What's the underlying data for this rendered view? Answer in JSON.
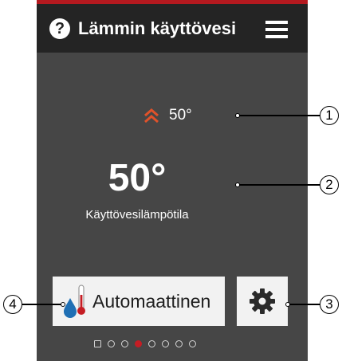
{
  "header": {
    "title": "Lämmin käyttövesi",
    "help_icon_text": "?"
  },
  "setpoint": {
    "value": "50°",
    "icon": "double-chevron-up-icon",
    "icon_color": "#e0522a"
  },
  "current": {
    "value": "50°",
    "label": "Käyttövesilämpötila"
  },
  "mode_button": {
    "label": "Automaattinen",
    "icon": "water-temperature-icon"
  },
  "settings_button": {
    "icon": "gear-icon"
  },
  "pagination": {
    "count": 8,
    "active_index": 3
  },
  "callouts": [
    "1",
    "2",
    "3",
    "4"
  ],
  "colors": {
    "panel": "#464646",
    "header": "#242424",
    "accent": "#c51d24",
    "button": "#f2f2f2"
  }
}
